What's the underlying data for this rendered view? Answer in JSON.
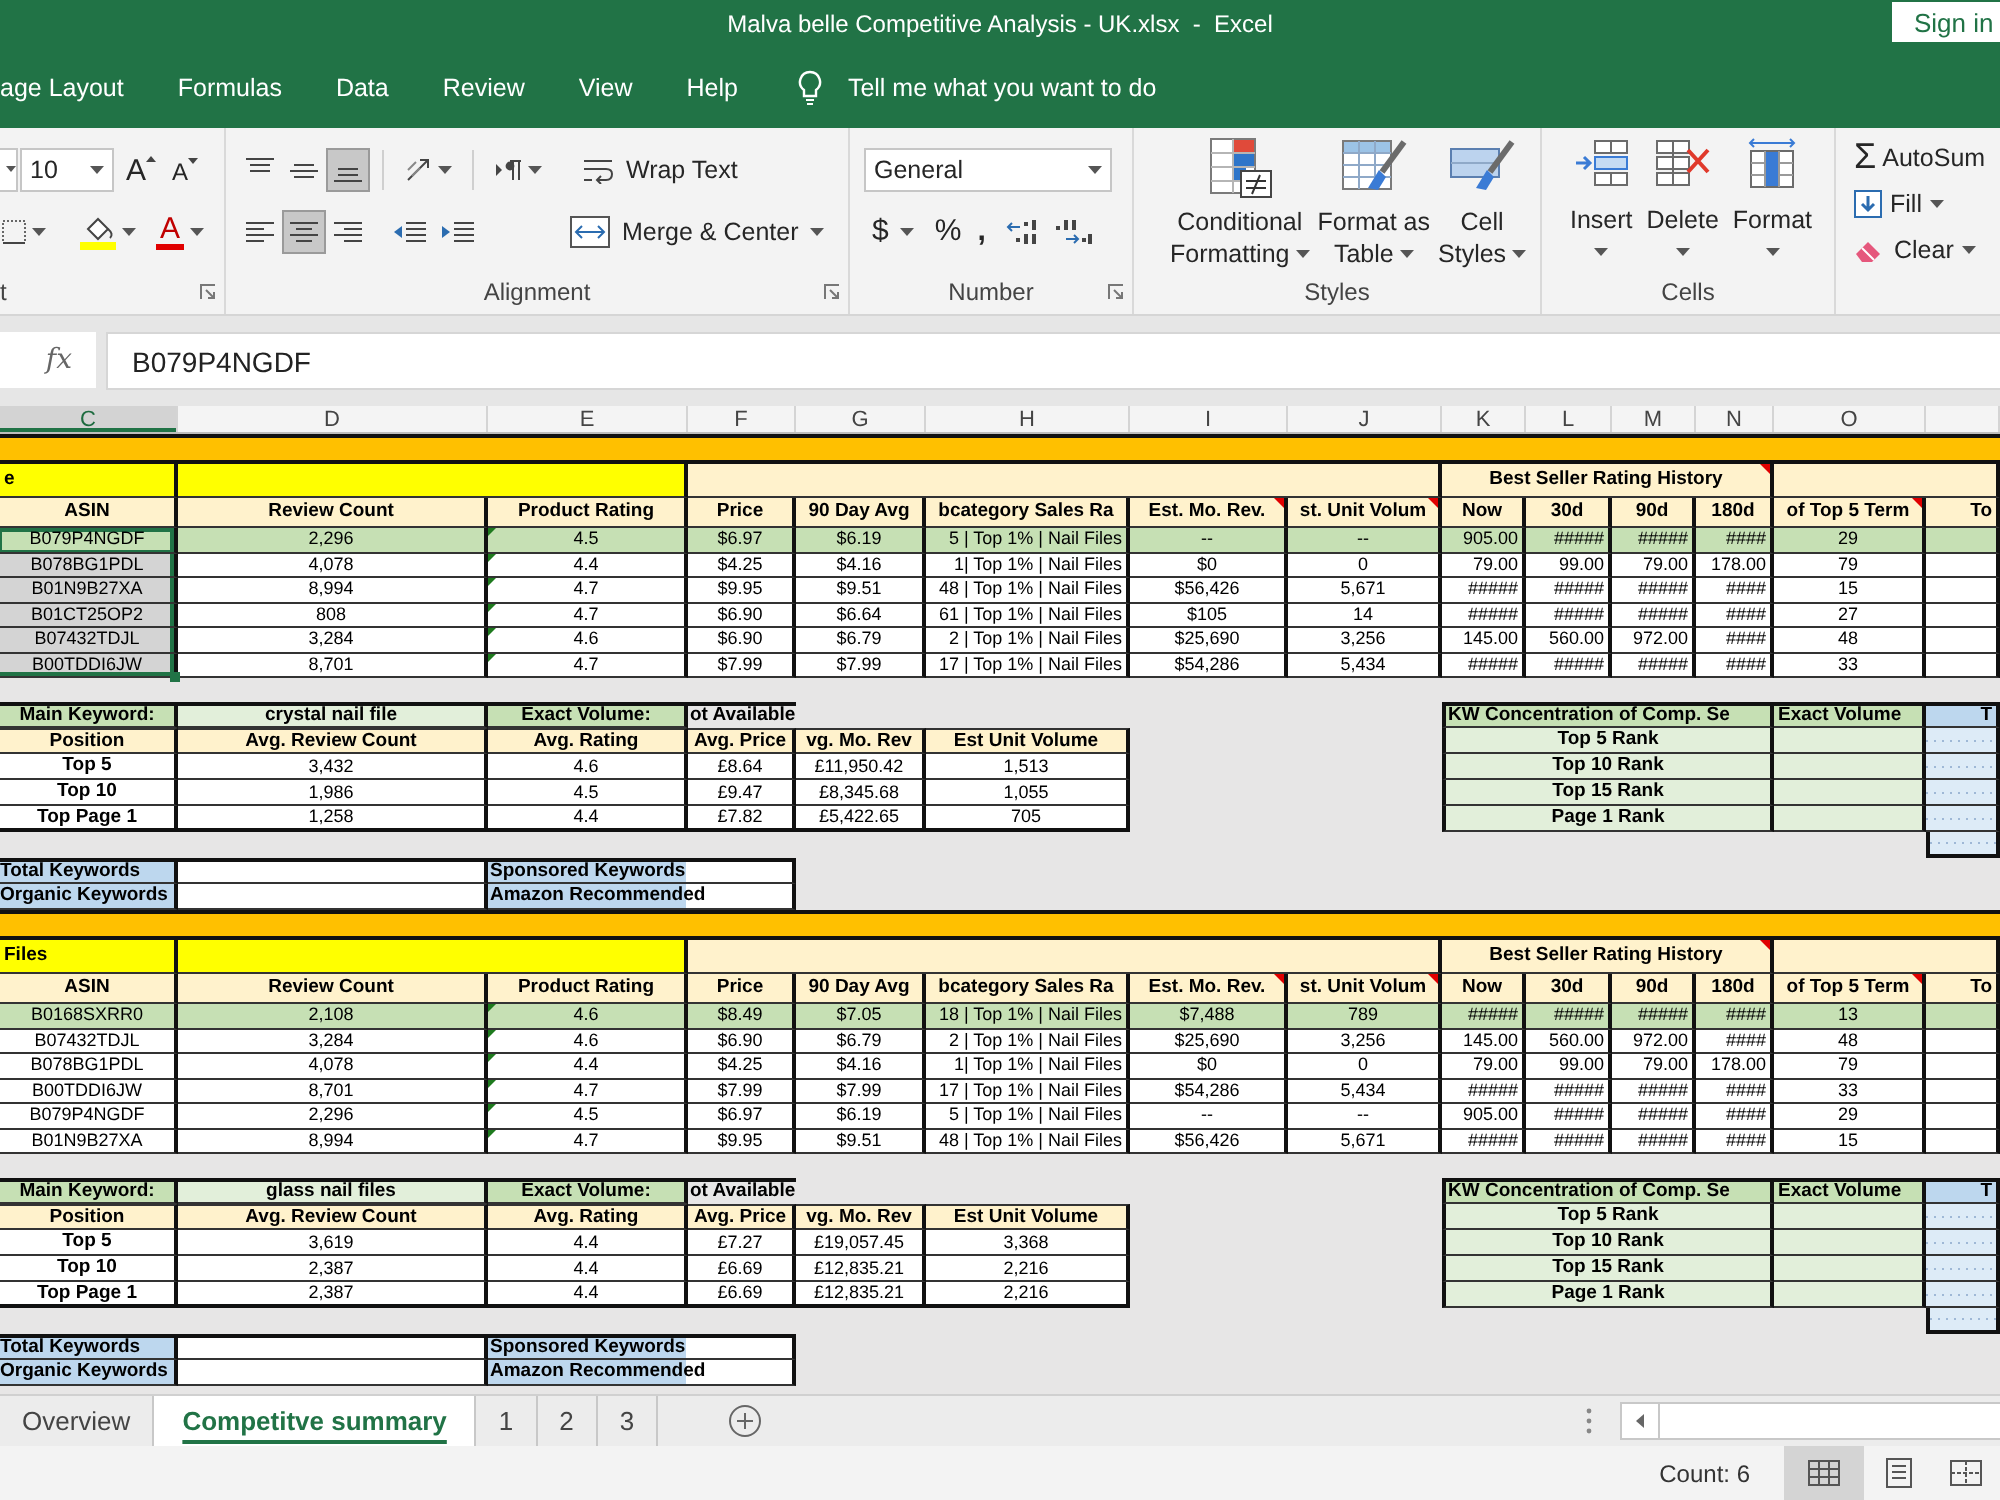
{
  "window": {
    "title": "Malva belle Competitive Analysis - UK.xlsx  -  Excel",
    "sign_in": "Sign in"
  },
  "menu": {
    "tabs": [
      {
        "label": "age Layout",
        "selected": false
      },
      {
        "label": "Formulas",
        "selected": false
      },
      {
        "label": "Data",
        "selected": false
      },
      {
        "label": "Review",
        "selected": false
      },
      {
        "label": "View",
        "selected": false
      },
      {
        "label": "Help",
        "selected": false
      }
    ],
    "tell_me": "Tell me what you want to do"
  },
  "ribbon": {
    "font": {
      "size": "10",
      "grow": "A",
      "shrink": "A",
      "color_letter": "A",
      "label": "t"
    },
    "alignment": {
      "vertical": [
        {
          "kind": "top",
          "selected": false
        },
        {
          "kind": "middle",
          "selected": false
        },
        {
          "kind": "bottom",
          "selected": true
        }
      ],
      "horizontal": [
        {
          "kind": "left",
          "selected": false
        },
        {
          "kind": "center",
          "selected": true
        },
        {
          "kind": "right",
          "selected": false
        }
      ],
      "wrap_text": "Wrap Text",
      "merge_center": "Merge & Center",
      "label": "Alignment"
    },
    "number": {
      "format": "General",
      "currency": "$",
      "percent": "%",
      "comma": ",",
      "label": "Number"
    },
    "styles": {
      "buttons": [
        {
          "kind": "conditional",
          "lines": [
            "Conditional",
            "Formatting"
          ]
        },
        {
          "kind": "table",
          "lines": [
            "Format as",
            "Table"
          ]
        },
        {
          "kind": "cell",
          "lines": [
            "Cell",
            "Styles"
          ]
        }
      ],
      "label": "Styles"
    },
    "cells": {
      "buttons": [
        {
          "kind": "insert",
          "label": "Insert"
        },
        {
          "kind": "delete",
          "label": "Delete"
        },
        {
          "kind": "format",
          "label": "Format"
        }
      ],
      "label": "Cells"
    },
    "editing": {
      "sum_symbol": "Σ",
      "autosum": "AutoSum",
      "fill": "Fill",
      "clear": "Clear"
    }
  },
  "formula_bar": {
    "function": "fx",
    "value": "B079P4NGDF"
  },
  "columns": [
    {
      "label": "C",
      "selected": true
    },
    {
      "label": "D",
      "selected": false
    },
    {
      "label": "E",
      "selected": false
    },
    {
      "label": "F",
      "selected": false
    },
    {
      "label": "G",
      "selected": false
    },
    {
      "label": "H",
      "selected": false
    },
    {
      "label": "I",
      "selected": false
    },
    {
      "label": "J",
      "selected": false
    },
    {
      "label": "K",
      "selected": false
    },
    {
      "label": "L",
      "selected": false
    },
    {
      "label": "M",
      "selected": false
    },
    {
      "label": "N",
      "selected": false
    },
    {
      "label": "O",
      "selected": false
    }
  ],
  "blocks": [
    {
      "title": "e",
      "group_header": {
        "text": "Best Seller Rating History",
        "comment": true
      },
      "headers": [
        {
          "text": "ASIN",
          "comment": false
        },
        {
          "text": "Review Count",
          "comment": false
        },
        {
          "text": "Product Rating",
          "comment": false
        },
        {
          "text": "Price",
          "comment": false
        },
        {
          "text": "90 Day Avg",
          "comment": false
        },
        {
          "text": "bcategory Sales Ra",
          "comment": false
        },
        {
          "text": "Est. Mo. Rev.",
          "comment": true
        },
        {
          "text": "st. Unit Volum",
          "comment": true
        },
        {
          "text": "Now",
          "comment": false
        },
        {
          "text": "30d",
          "comment": false
        },
        {
          "text": "90d",
          "comment": false
        },
        {
          "text": "180d",
          "comment": false
        },
        {
          "text": "of Top 5 Term",
          "comment": true
        },
        {
          "text": "To",
          "comment": false
        }
      ],
      "rows": [
        {
          "highlighted": true,
          "asin_selected": true,
          "asin_active": true,
          "rating_flag": true,
          "cells": [
            "B079P4NGDF",
            "2,296",
            "4.5",
            "$6.97",
            "$6.19",
            "5 | Top 1% | Nail Files",
            "--",
            "--",
            "905.00",
            "#####",
            "#####",
            "####",
            "29"
          ]
        },
        {
          "highlighted": false,
          "asin_selected": true,
          "asin_active": false,
          "rating_flag": true,
          "cells": [
            "B078BG1PDL",
            "4,078",
            "4.4",
            "$4.25",
            "$4.16",
            "1| Top 1% | Nail Files",
            "$0",
            "0",
            "79.00",
            "99.00",
            "79.00",
            "178.00",
            "79"
          ]
        },
        {
          "highlighted": false,
          "asin_selected": true,
          "asin_active": false,
          "rating_flag": true,
          "cells": [
            "B01N9B27XA",
            "8,994",
            "4.7",
            "$9.95",
            "$9.51",
            "48 | Top 1% | Nail Files",
            "$56,426",
            "5,671",
            "#####",
            "#####",
            "#####",
            "####",
            "15"
          ]
        },
        {
          "highlighted": false,
          "asin_selected": true,
          "asin_active": false,
          "rating_flag": true,
          "cells": [
            "B01CT25OP2",
            "808",
            "4.7",
            "$6.90",
            "$6.64",
            "61 | Top 1% | Nail Files",
            "$105",
            "14",
            "#####",
            "#####",
            "#####",
            "####",
            "27"
          ]
        },
        {
          "highlighted": false,
          "asin_selected": true,
          "asin_active": false,
          "rating_flag": true,
          "cells": [
            "B07432TDJL",
            "3,284",
            "4.6",
            "$6.90",
            "$6.79",
            "2 | Top 1% | Nail Files",
            "$25,690",
            "3,256",
            "145.00",
            "560.00",
            "972.00",
            "####",
            "48"
          ]
        },
        {
          "highlighted": false,
          "asin_selected": true,
          "asin_active": false,
          "rating_flag": true,
          "cells": [
            "B00TDDI6JW",
            "8,701",
            "4.7",
            "$7.99",
            "$7.99",
            "17 | Top 1% | Nail Files",
            "$54,286",
            "5,434",
            "#####",
            "#####",
            "#####",
            "####",
            "33"
          ]
        }
      ],
      "keyword": {
        "label": "Main Keyword:",
        "value": "crystal nail file",
        "volume_label": "Exact Volume:",
        "volume_value": "ot Available"
      },
      "position_headers": [
        "Position",
        "Avg. Review Count",
        "Avg. Rating",
        "Avg. Price",
        "vg. Mo. Rev",
        "Est Unit Volume"
      ],
      "positions": [
        [
          "Top 5",
          "3,432",
          "4.6",
          "£8.64",
          "£11,950.42",
          "1,513"
        ],
        [
          "Top 10",
          "1,986",
          "4.5",
          "£9.47",
          "£8,345.68",
          "1,055"
        ],
        [
          "Top Page 1",
          "1,258",
          "4.4",
          "£7.82",
          "£5,422.65",
          "705"
        ]
      ],
      "concentration": {
        "header": "KW Concentration of Comp. Se",
        "volume_header": "Exact Volume",
        "extra_header": "T",
        "ranks": [
          "Top 5 Rank",
          "Top 10 Rank",
          "Top 15 Rank",
          "Page 1 Rank"
        ]
      },
      "keyword_stats": [
        {
          "label": "Total Keywords",
          "second_label": "Sponsored Keywords"
        },
        {
          "label": "Organic Keywords",
          "second_label": "Amazon Recommended"
        }
      ]
    },
    {
      "title": "Files",
      "group_header": {
        "text": "Best Seller Rating History",
        "comment": true
      },
      "headers": [
        {
          "text": "ASIN",
          "comment": false
        },
        {
          "text": "Review Count",
          "comment": false
        },
        {
          "text": "Product Rating",
          "comment": false
        },
        {
          "text": "Price",
          "comment": false
        },
        {
          "text": "90 Day Avg",
          "comment": false
        },
        {
          "text": "bcategory Sales Ra",
          "comment": false
        },
        {
          "text": "Est. Mo. Rev.",
          "comment": true
        },
        {
          "text": "st. Unit Volum",
          "comment": true
        },
        {
          "text": "Now",
          "comment": false
        },
        {
          "text": "30d",
          "comment": false
        },
        {
          "text": "90d",
          "comment": false
        },
        {
          "text": "180d",
          "comment": false
        },
        {
          "text": "of Top 5 Term",
          "comment": true
        },
        {
          "text": "To",
          "comment": false
        }
      ],
      "rows": [
        {
          "highlighted": true,
          "rating_flag": true,
          "cells": [
            "B0168SXRR0",
            "2,108",
            "4.6",
            "$8.49",
            "$7.05",
            "18 | Top 1% | Nail Files",
            "$7,488",
            "789",
            "#####",
            "#####",
            "#####",
            "####",
            "13"
          ]
        },
        {
          "highlighted": false,
          "rating_flag": true,
          "cells": [
            "B07432TDJL",
            "3,284",
            "4.6",
            "$6.90",
            "$6.79",
            "2 | Top 1% | Nail Files",
            "$25,690",
            "3,256",
            "145.00",
            "560.00",
            "972.00",
            "####",
            "48"
          ]
        },
        {
          "highlighted": false,
          "rating_flag": true,
          "cells": [
            "B078BG1PDL",
            "4,078",
            "4.4",
            "$4.25",
            "$4.16",
            "1| Top 1% | Nail Files",
            "$0",
            "0",
            "79.00",
            "99.00",
            "79.00",
            "178.00",
            "79"
          ]
        },
        {
          "highlighted": false,
          "rating_flag": true,
          "cells": [
            "B00TDDI6JW",
            "8,701",
            "4.7",
            "$7.99",
            "$7.99",
            "17 | Top 1% | Nail Files",
            "$54,286",
            "5,434",
            "#####",
            "#####",
            "#####",
            "####",
            "33"
          ]
        },
        {
          "highlighted": false,
          "rating_flag": true,
          "cells": [
            "B079P4NGDF",
            "2,296",
            "4.5",
            "$6.97",
            "$6.19",
            "5 | Top 1% | Nail Files",
            "--",
            "--",
            "905.00",
            "#####",
            "#####",
            "####",
            "29"
          ]
        },
        {
          "highlighted": false,
          "rating_flag": true,
          "cells": [
            "B01N9B27XA",
            "8,994",
            "4.7",
            "$9.95",
            "$9.51",
            "48 | Top 1% | Nail Files",
            "$56,426",
            "5,671",
            "#####",
            "#####",
            "#####",
            "####",
            "15"
          ]
        }
      ],
      "keyword": {
        "label": "Main Keyword:",
        "value": "glass nail files",
        "volume_label": "Exact Volume:",
        "volume_value": "ot Available"
      },
      "position_headers": [
        "Position",
        "Avg. Review Count",
        "Avg. Rating",
        "Avg. Price",
        "vg. Mo. Rev",
        "Est Unit Volume"
      ],
      "positions": [
        [
          "Top 5",
          "3,619",
          "4.4",
          "£7.27",
          "£19,057.45",
          "3,368"
        ],
        [
          "Top 10",
          "2,387",
          "4.4",
          "£6.69",
          "£12,835.21",
          "2,216"
        ],
        [
          "Top Page 1",
          "2,387",
          "4.4",
          "£6.69",
          "£12,835.21",
          "2,216"
        ]
      ],
      "concentration": {
        "header": "KW Concentration of Comp. Se",
        "volume_header": "Exact Volume",
        "extra_header": "T",
        "ranks": [
          "Top 5 Rank",
          "Top 10 Rank",
          "Top 15 Rank",
          "Page 1 Rank"
        ]
      },
      "keyword_stats": [
        {
          "label": "Total Keywords",
          "second_label": "Sponsored Keywords"
        },
        {
          "label": "Organic Keywords",
          "second_label": "Amazon Recommended"
        }
      ]
    }
  ],
  "sheet_tabs": [
    {
      "label": "Overview",
      "selected": false
    },
    {
      "label": "Competitve summary",
      "selected": true
    },
    {
      "label": "1",
      "selected": false
    },
    {
      "label": "2",
      "selected": false
    },
    {
      "label": "3",
      "selected": false
    }
  ],
  "status_bar": {
    "count": "Count: 6",
    "views": [
      {
        "kind": "normal",
        "selected": true
      },
      {
        "kind": "page_layout",
        "selected": false
      },
      {
        "kind": "page_break",
        "selected": false
      }
    ]
  }
}
